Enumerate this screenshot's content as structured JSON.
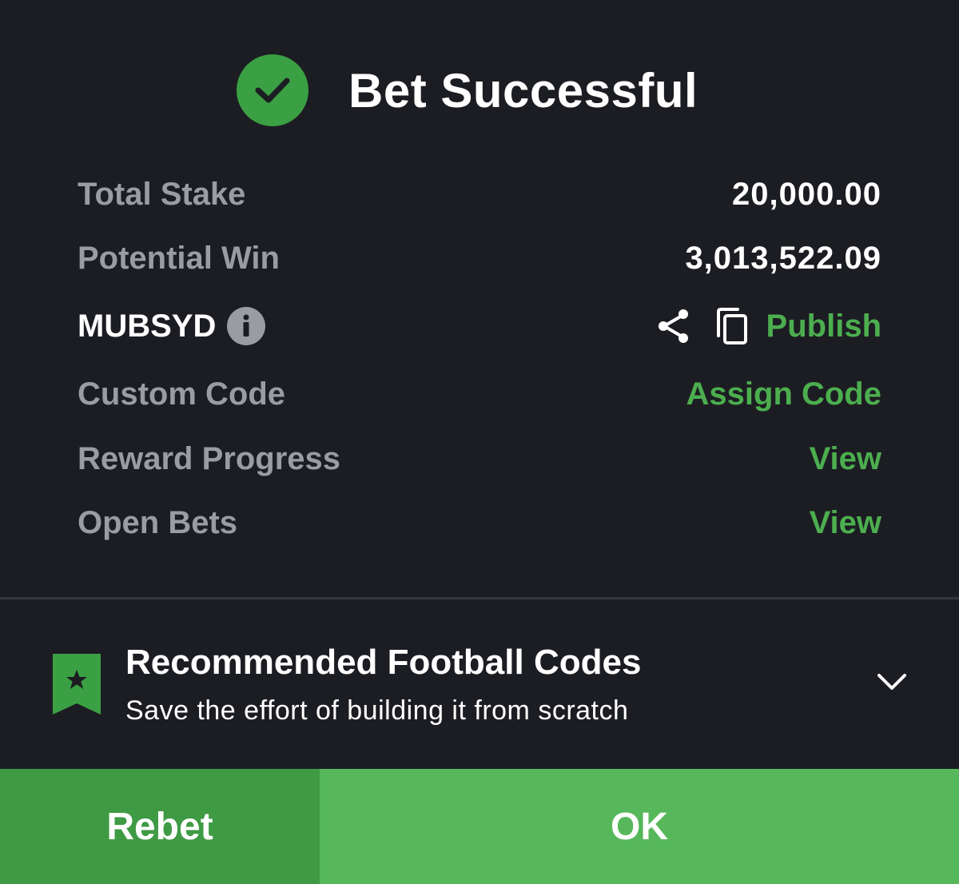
{
  "header": {
    "title": "Bet Successful",
    "icon": "check-circle-icon"
  },
  "summary": {
    "total_stake_label": "Total Stake",
    "total_stake_value": "20,000.00",
    "potential_win_label": "Potential Win",
    "potential_win_value": "3,013,522.09",
    "booking_code": "MUBSYD",
    "publish_label": "Publish",
    "custom_code_label": "Custom Code",
    "assign_code_label": "Assign Code",
    "reward_progress_label": "Reward Progress",
    "reward_progress_link": "View",
    "open_bets_label": "Open Bets",
    "open_bets_link": "View"
  },
  "recommended": {
    "title": "Recommended Football Codes",
    "subtitle": "Save the effort of building it from scratch"
  },
  "actions": {
    "rebet_label": "Rebet",
    "ok_label": "OK"
  },
  "colors": {
    "background": "#1c1d22",
    "accent_green": "#4cae4f",
    "success_green": "#3aa043",
    "rebet_button": "#3f9a44",
    "ok_button": "#56b85a",
    "muted_text": "#9a9ca3"
  }
}
